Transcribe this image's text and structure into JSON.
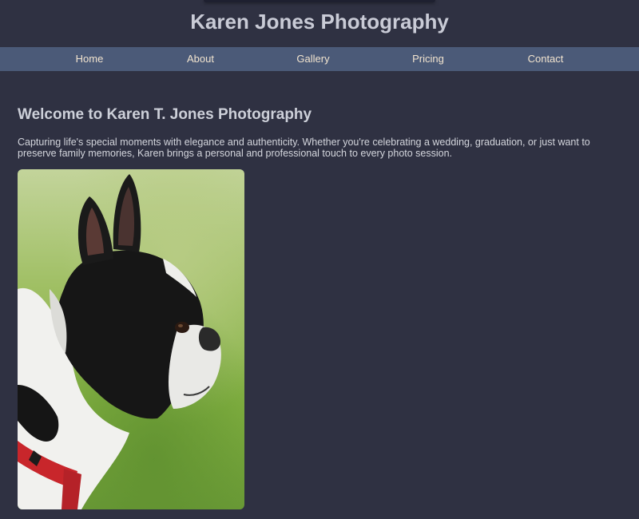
{
  "site": {
    "title": "Karen Jones Photography"
  },
  "nav": {
    "items": [
      {
        "label": "Home"
      },
      {
        "label": "About"
      },
      {
        "label": "Gallery"
      },
      {
        "label": "Pricing"
      },
      {
        "label": "Contact"
      }
    ]
  },
  "main": {
    "heading": "Welcome to Karen T. Jones Photography",
    "intro": "Capturing life's special moments with elegance and authenticity. Whether you're celebrating a wedding, graduation, or just want to preserve family memories, Karen brings a personal and professional touch to every photo session.",
    "photo": {
      "subject": "boston-terrier-profile-photo"
    }
  },
  "colors": {
    "background": "#2f3142",
    "nav_bar": "#4b5a78",
    "nav_text": "#f2e4cf",
    "title_text": "#c9cbd6"
  }
}
